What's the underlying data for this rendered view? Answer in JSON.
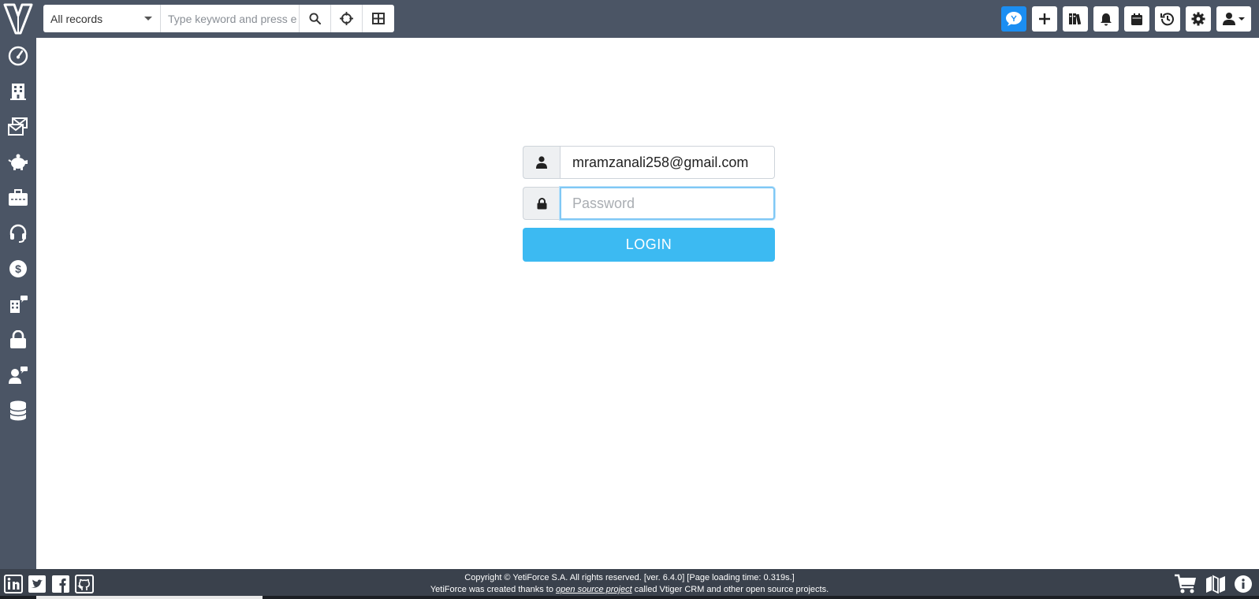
{
  "topbar": {
    "search_module": "All records",
    "search_placeholder": "Type keyword and press enter",
    "buttons": [
      {
        "name": "chat-icon"
      },
      {
        "name": "plus-icon"
      },
      {
        "name": "books-icon"
      },
      {
        "name": "bell-icon"
      },
      {
        "name": "calendar-icon"
      },
      {
        "name": "history-icon"
      },
      {
        "name": "gear-icon"
      },
      {
        "name": "user-icon"
      }
    ]
  },
  "sidebar": {
    "items": [
      {
        "name": "dashboard-icon"
      },
      {
        "name": "building-icon"
      },
      {
        "name": "mails-icon"
      },
      {
        "name": "piggy-bank-icon"
      },
      {
        "name": "briefcase-icon"
      },
      {
        "name": "headset-icon"
      },
      {
        "name": "dollar-icon"
      },
      {
        "name": "building-chat-icon"
      },
      {
        "name": "lock-icon"
      },
      {
        "name": "user-chat-icon"
      },
      {
        "name": "database-icon"
      }
    ]
  },
  "login": {
    "email_value": "mramzanali258@gmail.com",
    "password_placeholder": "Password",
    "button_label": "LOGIN"
  },
  "footer": {
    "line1": "Copyright © YetiForce S.A. All rights reserved. [ver. 6.4.0] [Page loading time: 0.319s.]",
    "line2_prefix": "YetiForce was created thanks to ",
    "line2_link": "open source project",
    "line2_suffix": " called Vtiger CRM and other open source projects.",
    "social": [
      "linkedin-icon",
      "twitter-icon",
      "facebook-icon",
      "github-icon"
    ],
    "right": [
      "cart-icon",
      "book-map-icon",
      "info-icon"
    ]
  },
  "colors": {
    "bar": "#4b5565",
    "footer": "#3a414c",
    "accent": "#3cbaf2",
    "chat": "#1b8ef2"
  }
}
